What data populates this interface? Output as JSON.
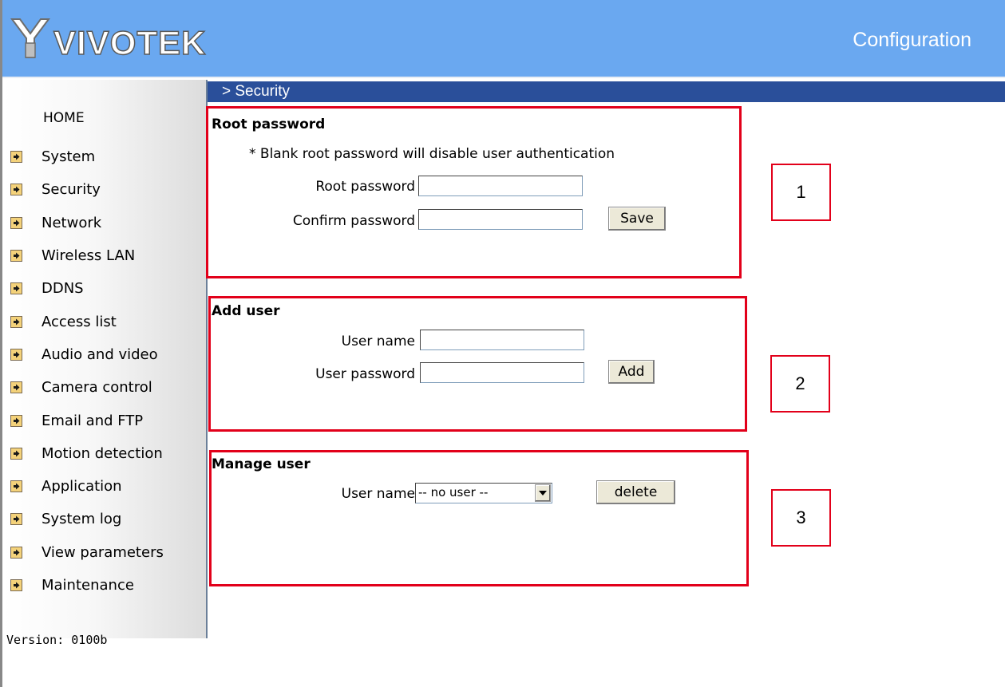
{
  "header": {
    "logo_text": "VIVOTEK",
    "title": "Configuration",
    "colors": {
      "header_bg": "#6aa8f0",
      "section_bar": "#2a4f9a",
      "annotation_red": "#e2001a"
    }
  },
  "breadcrumb": "> Security",
  "sidebar": {
    "home": "HOME",
    "items": [
      {
        "label": "System",
        "icon": "arrow-right-icon"
      },
      {
        "label": "Security",
        "icon": "arrow-right-icon"
      },
      {
        "label": "Network",
        "icon": "arrow-right-icon"
      },
      {
        "label": "Wireless LAN",
        "icon": "arrow-right-icon"
      },
      {
        "label": "DDNS",
        "icon": "arrow-right-icon"
      },
      {
        "label": "Access list",
        "icon": "arrow-right-icon"
      },
      {
        "label": "Audio and video",
        "icon": "arrow-right-icon"
      },
      {
        "label": "Camera control",
        "icon": "arrow-right-icon"
      },
      {
        "label": "Email and FTP",
        "icon": "arrow-right-icon"
      },
      {
        "label": "Motion detection",
        "icon": "arrow-right-icon"
      },
      {
        "label": "Application",
        "icon": "arrow-right-icon"
      },
      {
        "label": "System log",
        "icon": "arrow-right-icon"
      },
      {
        "label": "View parameters",
        "icon": "arrow-right-icon"
      },
      {
        "label": "Maintenance",
        "icon": "arrow-right-icon"
      }
    ],
    "version": "Version: 0100b"
  },
  "root_password": {
    "title": "Root password",
    "note": "* Blank root password will disable user authentication",
    "password_label": "Root password",
    "password_value": "",
    "confirm_label": "Confirm password",
    "confirm_value": "",
    "save_label": "Save"
  },
  "add_user": {
    "title": "Add user",
    "username_label": "User name",
    "username_value": "",
    "password_label": "User password",
    "password_value": "",
    "add_label": "Add"
  },
  "manage_user": {
    "title": "Manage user",
    "username_label": "User name",
    "selected_user": "-- no user --",
    "delete_label": "delete"
  },
  "callouts": [
    "1",
    "2",
    "3"
  ]
}
